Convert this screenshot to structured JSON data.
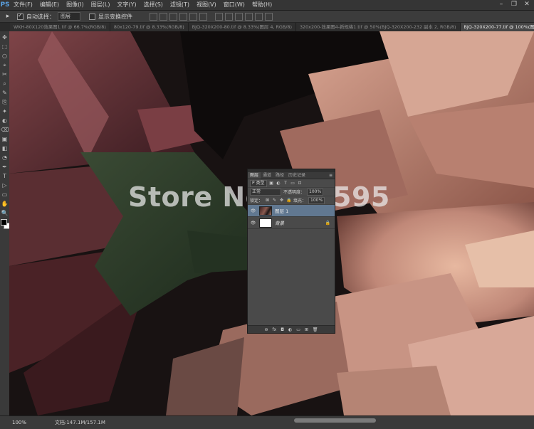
{
  "app": {
    "logo": "PS"
  },
  "menu": [
    "文件(F)",
    "编辑(E)",
    "图像(I)",
    "图层(L)",
    "文字(Y)",
    "选择(S)",
    "滤镜(T)",
    "视图(V)",
    "窗口(W)",
    "帮助(H)"
  ],
  "window_controls": {
    "minimize": "–",
    "restore": "❐",
    "close": "✕"
  },
  "options": {
    "tool_icon": "▸",
    "auto_select_label": "自动选择：",
    "auto_select_value": "图层",
    "show_transform_label": "显示变换控件"
  },
  "tabs": [
    "WKH-80X120效果图1.tif @ 66.7%(RGB/8)",
    "80x120-79.tif @ 8.33%(RGB/8)",
    "BJQ-320X200-80.tif @ 8.33%(图层 4, RGB/8)",
    "320x200-效果图4-新规格1.tif @ 50%(BJQ-320X200-232 副本 2, RGB/8)",
    "BJQ-320X200-77.tif @ 100%(图层 1, RGB/8)"
  ],
  "active_tab_index": 4,
  "tools": [
    "✥",
    "⬚",
    "○",
    "⌖",
    "✂",
    "⌕",
    "✎",
    "⎘",
    "✦",
    "◐",
    "⌫",
    "▣",
    "◧",
    "◔",
    "✒",
    "T",
    "▷",
    "▭",
    "✋",
    "🔍"
  ],
  "watermark": "Store No.515595",
  "layers_panel": {
    "tabs": [
      "图层",
      "通道",
      "路径",
      "历史记录"
    ],
    "menu_icon": "≡",
    "filter_label": "P 类型",
    "blend_mode": "正常",
    "opacity_label": "不透明度：",
    "opacity_value": "100%",
    "lock_label": "锁定：",
    "fill_label": "填充：",
    "fill_value": "100%",
    "layers": [
      {
        "name": "图层 1",
        "selected": true,
        "visible": true,
        "thumb": "photo"
      },
      {
        "name": "背景",
        "selected": false,
        "visible": true,
        "thumb": "white",
        "locked": true
      }
    ],
    "footer_icons": [
      "⊖",
      "fx",
      "◘",
      "◐",
      "▭",
      "⊞",
      "🗑"
    ]
  },
  "status": {
    "zoom": "100%",
    "doc_size": "文档:147.1M/157.1M"
  },
  "colors": {
    "foreground": "#000000",
    "background": "#ffffff",
    "selected_layer": "#617891"
  }
}
